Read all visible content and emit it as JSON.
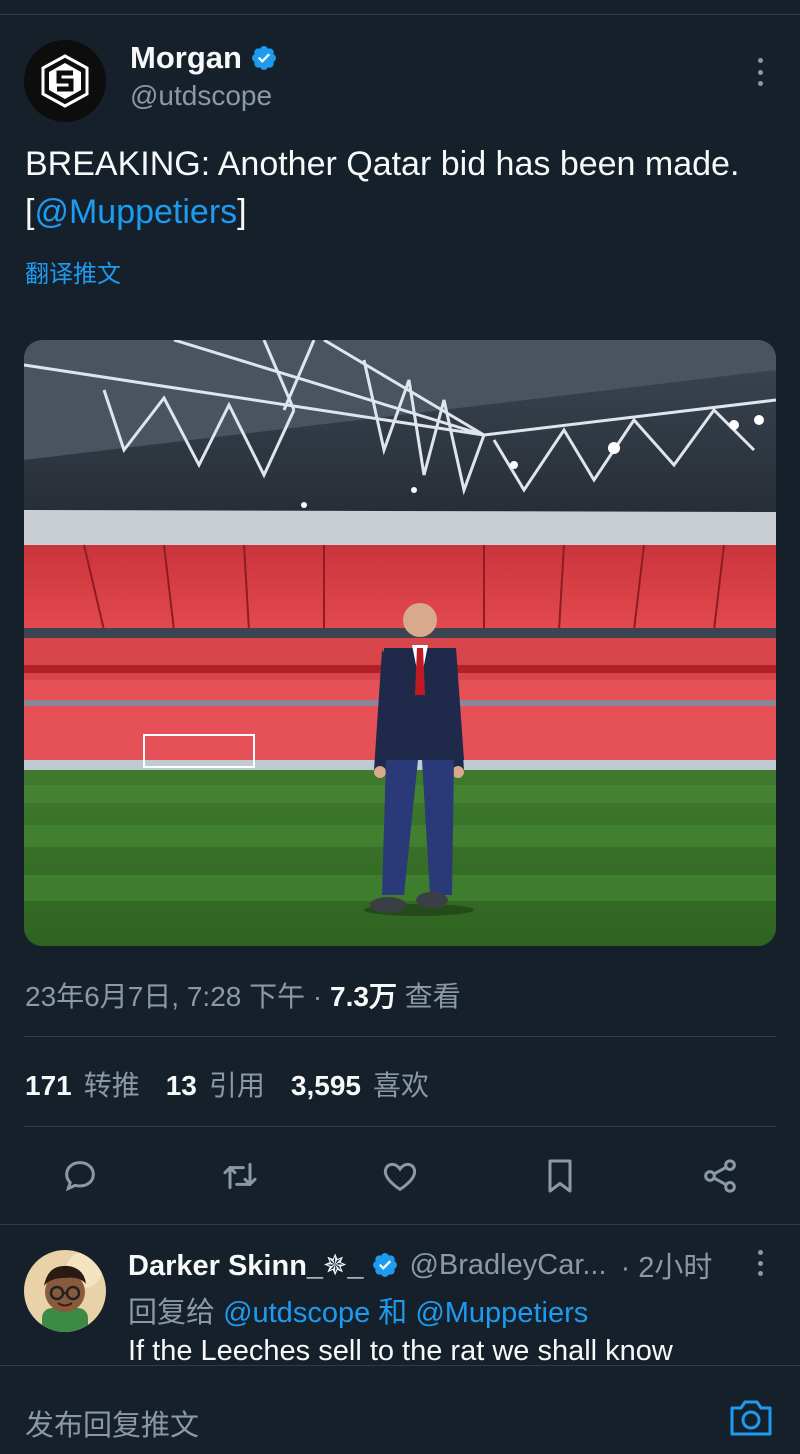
{
  "tweet": {
    "author_name": "Morgan",
    "author_handle": "@utdscope",
    "text_before": "BREAKING: Another Qatar bid has been made. [",
    "mention": "@Muppetiers",
    "text_after": "]",
    "translate_label": "翻译推文",
    "date": "23年6月7日, 7:28 下午 · ",
    "views_count": "7.3万",
    "views_label": " 查看"
  },
  "stats": {
    "retweets": "171",
    "retweets_label": "转推",
    "quotes": "13",
    "quotes_label": "引用",
    "likes": "3,595",
    "likes_label": "喜欢"
  },
  "actions": [
    "reply-icon",
    "retweet-icon",
    "like-icon",
    "bookmark-icon",
    "share-icon"
  ],
  "reply": {
    "author_name": "Darker Skinn_✵_",
    "author_handle": "@BradleyCar...",
    "time": "· 2小时",
    "replying_prefix": "回复给 ",
    "replying_to_1": "@utdscope",
    "replying_and": " 和 ",
    "replying_to_2": "@Muppetiers",
    "text": "If the Leeches sell to the rat we shall know"
  },
  "compose": {
    "placeholder": "发布回复推文"
  },
  "colors": {
    "background": "#15202b",
    "accent": "#1d9bf0",
    "muted": "#8b98a5",
    "text": "#f7f9f9"
  }
}
